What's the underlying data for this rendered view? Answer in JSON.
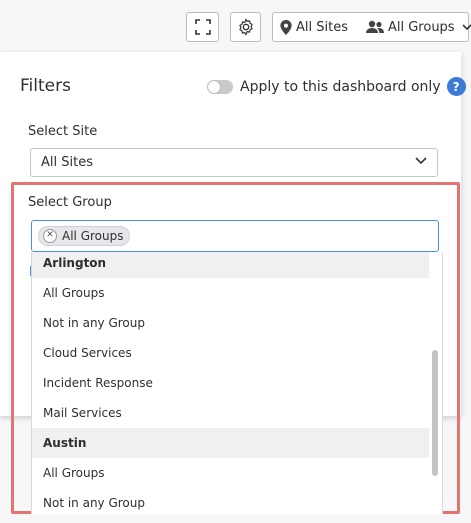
{
  "toolbar": {
    "expand_icon": "expand-icon",
    "settings_icon": "gear-icon",
    "sites_label": "All Sites",
    "groups_label": "All Groups"
  },
  "filters": {
    "title": "Filters",
    "toggle_label": "Apply to this dashboard only",
    "toggle_on": false,
    "help_glyph": "?",
    "site_label": "Select Site",
    "site_value": "All Sites",
    "group_label": "Select Group",
    "group_chip": "All Groups"
  },
  "dropdown": {
    "rows": [
      {
        "text": "Arlington",
        "type": "group"
      },
      {
        "text": "All Groups",
        "type": "option"
      },
      {
        "text": "Not in any Group",
        "type": "option"
      },
      {
        "text": "Cloud Services",
        "type": "option"
      },
      {
        "text": "Incident Response",
        "type": "option"
      },
      {
        "text": "Mail Services",
        "type": "option"
      },
      {
        "text": "Austin",
        "type": "group"
      },
      {
        "text": "All Groups",
        "type": "option"
      },
      {
        "text": "Not in any Group",
        "type": "option"
      }
    ]
  },
  "colors": {
    "highlight": "#e57373",
    "focus": "#4a90e2",
    "help": "#3a7bd5"
  }
}
